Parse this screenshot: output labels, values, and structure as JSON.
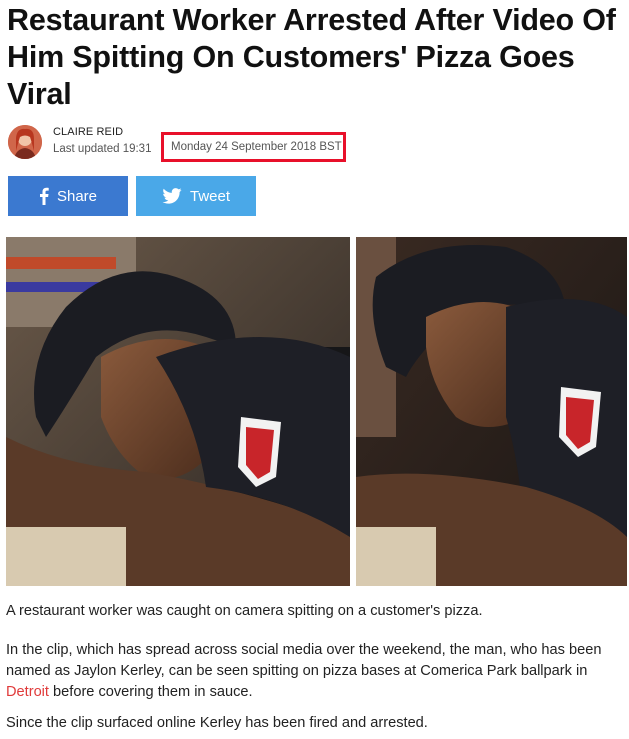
{
  "article": {
    "headline": "Restaurant Worker Arrested After Video Of Him Spitting On Customers' Pizza Goes Viral",
    "author": "CLAIRE REID",
    "updated_prefix": "Last updated 19:31",
    "updated_date": "Monday 24 September 2018 BST"
  },
  "share": {
    "facebook_label": "Share",
    "twitter_label": "Tweet"
  },
  "body": {
    "p1": "A restaurant worker was caught on camera spitting on a customer's pizza.",
    "p2_before": "In the clip, which has spread across social media over the weekend, the man, who has been named as Jaylon Kerley, can be seen spitting on pizza bases at Comerica Park ballpark in ",
    "p2_link": "Detroit",
    "p2_after": " before covering them in sauce.",
    "p3": "Since the clip surfaced online Kerley has been fired and arrested."
  },
  "colors": {
    "facebook": "#3b79d0",
    "twitter": "#4aa8e8",
    "highlight_box": "#e8102a",
    "link": "#e03a3a"
  },
  "icons": {
    "facebook": "facebook-icon",
    "twitter": "twitter-icon"
  }
}
